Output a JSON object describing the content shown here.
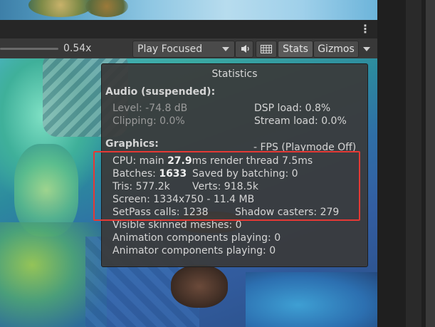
{
  "toolbar": {
    "zoom_value": "0.54x",
    "play_mode": "Play Focused",
    "stats_label": "Stats",
    "gizmos_label": "Gizmos",
    "speaker_icon": "speaker-icon",
    "grid_icon": "grid-icon",
    "menu_icon": "kebab-menu-icon"
  },
  "stats": {
    "title": "Statistics",
    "audio_header": "Audio (suspended):",
    "level": "Level: -74.8 dB",
    "clipping": "Clipping: 0.0%",
    "dsp_load": "DSP load: 0.8%",
    "stream_load": "Stream load: 0.0%",
    "graphics_header": "Graphics:",
    "fps": "- FPS (Playmode Off)",
    "cpu_label": "CPU: main ",
    "cpu_main": "27.9",
    "cpu_rest": "ms  render thread 7.5ms",
    "batches_label": "Batches: ",
    "batches_value": "1633",
    "saved_batching": "Saved by batching: 0",
    "tris": "Tris: 577.2k",
    "verts": "Verts: 918.5k",
    "screen": "Screen: 1334x750 - 11.4 MB",
    "setpass": "SetPass calls: 1238",
    "shadow_casters": "Shadow casters: 279",
    "skinned_meshes": "Visible skinned meshes: 0",
    "animation_components": "Animation components playing: 0",
    "animator_components": "Animator components playing: 0"
  },
  "colors": {
    "highlight": "#e53935",
    "panel": "#3a3a3a",
    "toolbar": "#383838"
  }
}
